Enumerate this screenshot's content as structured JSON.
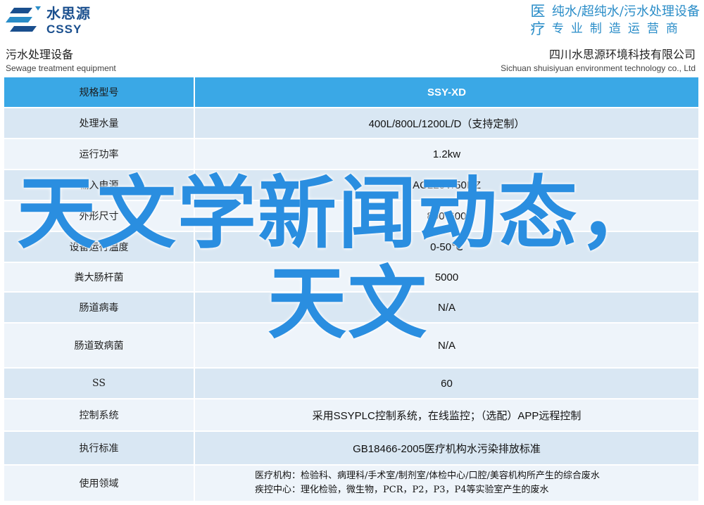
{
  "header": {
    "logo_cn": "水思源",
    "logo_en": "CSSY",
    "slogan_big_1": "医",
    "slogan_big_2": "疗",
    "slogan_line1": "纯水/超纯水/污水处理设备",
    "slogan_line2": "专业制造运营商"
  },
  "subheader": {
    "left_cn": "污水处理设备",
    "left_en": "Sewage treatment equipment",
    "right_cn": "四川水思源环境科技有限公司",
    "right_en": "Sichuan shuisiyuan environment technology co., Ltd"
  },
  "table": {
    "header_label": "规格型号",
    "header_value": "SSY-XD",
    "rows": [
      {
        "label": "处理水量",
        "value": "400L/800L/1200L/D（支持定制）"
      },
      {
        "label": "运行功率",
        "value": "1.2kw"
      },
      {
        "label": "输入电源",
        "value": "AC220V/50HZ"
      },
      {
        "label": "外形尺寸",
        "value": "800*600"
      },
      {
        "label": "设备运行温度",
        "value": "0-50℃"
      },
      {
        "label": "粪大肠杆菌",
        "value": "5000"
      },
      {
        "label": "肠道病毒",
        "value": "N/A"
      },
      {
        "label": "肠道致病菌",
        "value": "N/A"
      },
      {
        "label": "SS",
        "value": "60"
      },
      {
        "label": "控制系统",
        "value": "采用SSYPLC控制系统，在线监控；（选配）APP远程控制"
      },
      {
        "label": "执行标准",
        "value": "GB18466-2005医疗机构水污染排放标准"
      }
    ],
    "usage_label": "使用领域",
    "usage_line1": "医疗机构：检验科、病理科/手术室/制剂室/体检中心/口腔/美容机构所产生的综合废水",
    "usage_line2": "疾控中心：理化检验，微生物，PCR，P2，P3，P4等实验室产生的废水"
  },
  "overlay": {
    "line1": "天文学新闻动态，",
    "line2": "天文"
  },
  "colors": {
    "header_blue": "#3aa8e6",
    "row_alt": "#d9e7f3",
    "row_plain": "#eef4fa",
    "overlay_text": "#2a8ee0",
    "brand": "#1a4f8e"
  }
}
